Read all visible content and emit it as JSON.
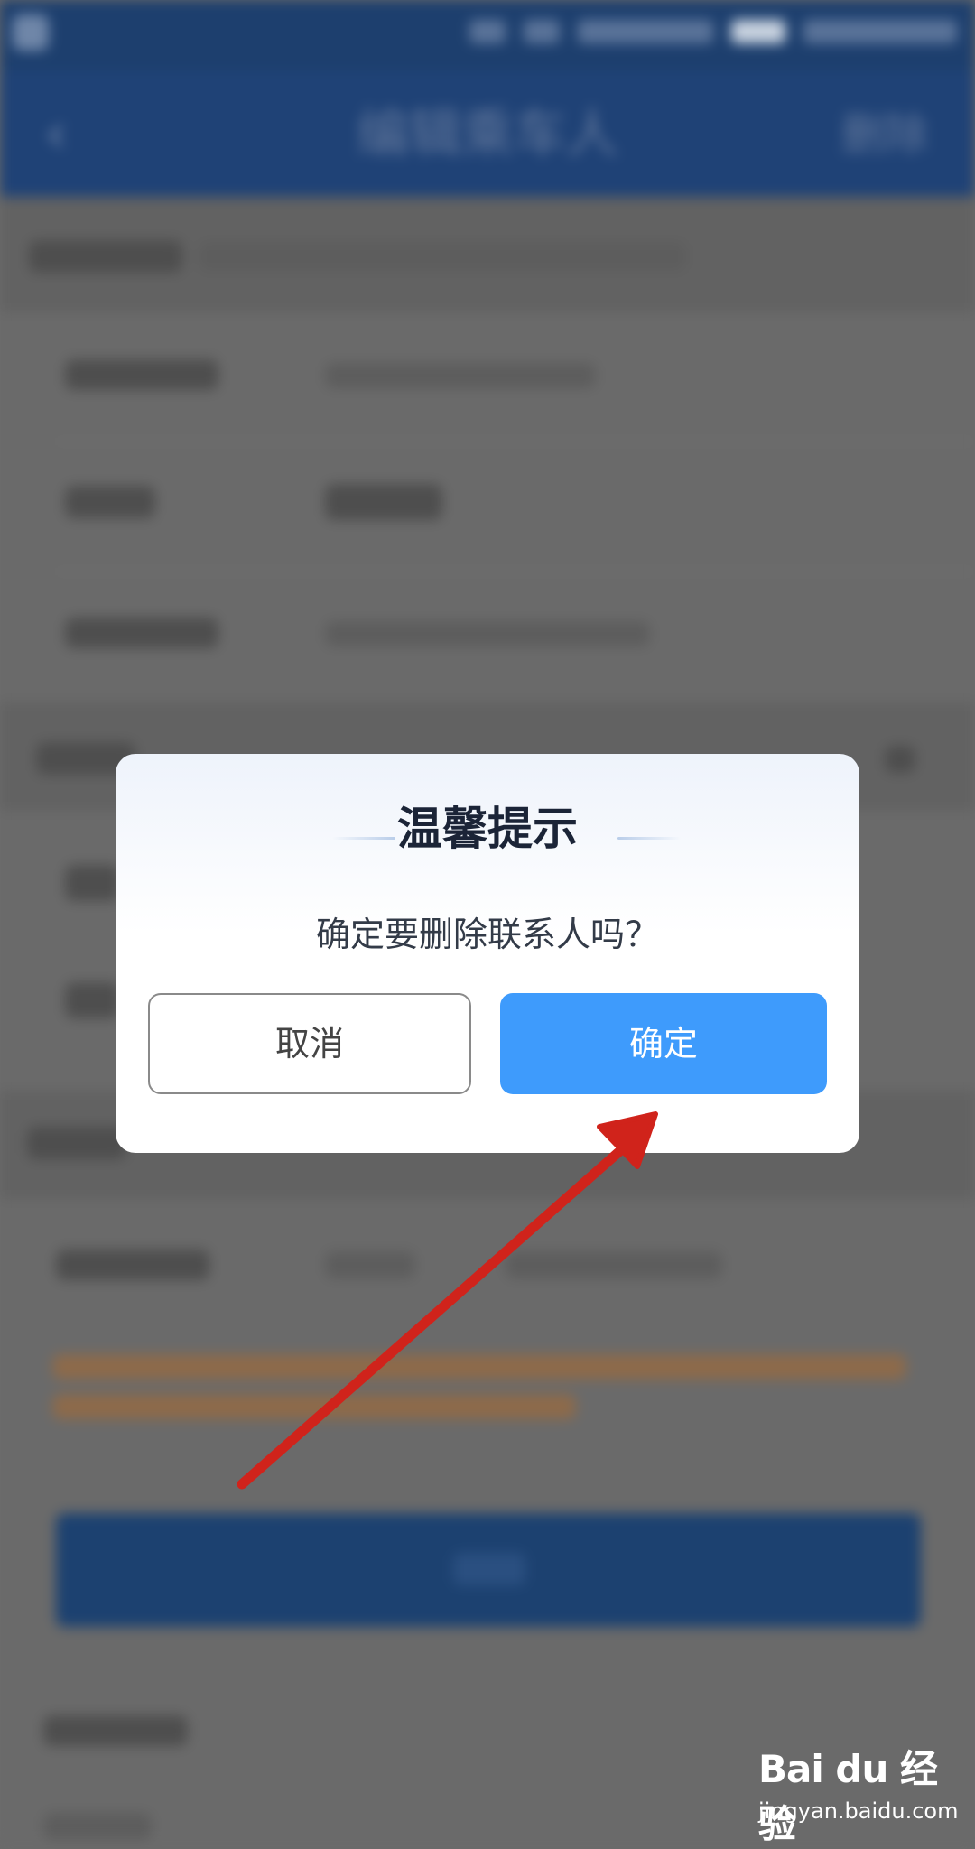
{
  "navbar": {
    "title": "编辑乘车人",
    "delete_label": "删除"
  },
  "dialog": {
    "title": "温馨提示",
    "message": "确定要删除联系人吗？",
    "cancel_label": "取消",
    "confirm_label": "确定"
  },
  "watermark": {
    "brand": "Bai du 经验",
    "url": "jingyan.baidu.com"
  },
  "colors": {
    "navbar": "#1f4276",
    "confirm_button": "#3e9bfc",
    "arrow": "#d0231b"
  }
}
